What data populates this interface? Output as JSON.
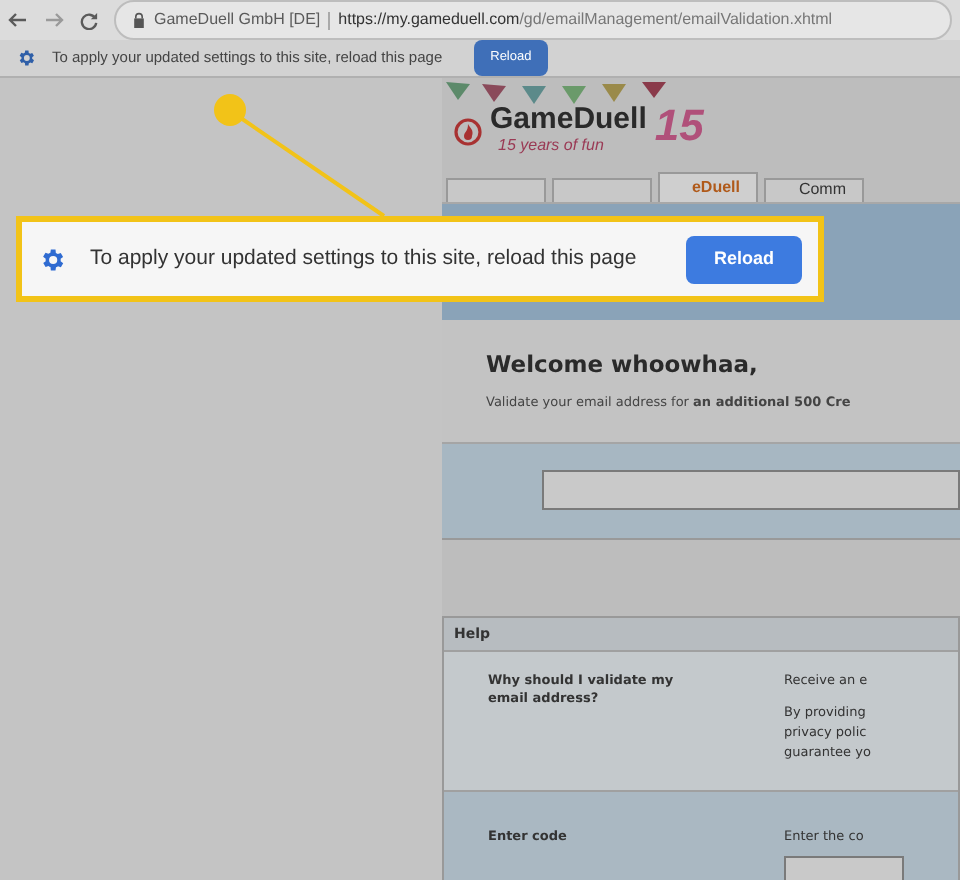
{
  "browser": {
    "site_name": "GameDuell GmbH [DE]",
    "url_host": "https://my.gameduell.com",
    "url_path": "/gd/emailManagement/emailValidation.xhtml"
  },
  "infobar": {
    "message": "To apply your updated settings to this site, reload this page",
    "button": "Reload"
  },
  "callout": {
    "message": "To apply your updated settings to this site, reload this page",
    "button": "Reload"
  },
  "logo": {
    "name": "GameDuell",
    "tagline": "15 years of fun",
    "badge": "15"
  },
  "tabs": [
    {
      "selected": false
    },
    {
      "selected": false
    },
    {
      "label": "eDuell",
      "selected": true
    },
    {
      "label": "Comm",
      "selected": false
    }
  ],
  "welcome": {
    "title": "Welcome whoowhaa,",
    "text": "Validate your email address for **an additional 500 Cre**"
  },
  "help": {
    "title": "Help",
    "rows": [
      {
        "question": "Why should I validate my email address?",
        "answers": [
          "Receive an e",
          "By providing",
          "privacy polic",
          "guarantee yo"
        ]
      }
    ],
    "code_label": "Enter code",
    "code_hint": "Enter the co"
  }
}
